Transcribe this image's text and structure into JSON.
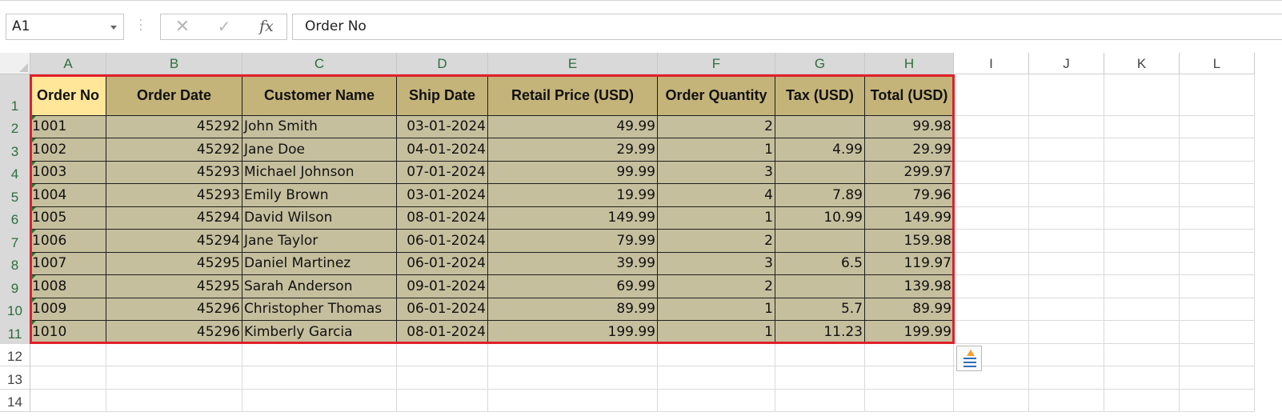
{
  "formula_bar": {
    "name_box": "A1",
    "cancel_icon": "cancel-icon",
    "enter_icon": "checkmark-icon",
    "fx_label": "fx",
    "formula_value": "Order No"
  },
  "columns": [
    "A",
    "B",
    "C",
    "D",
    "E",
    "F",
    "G",
    "H",
    "I",
    "J",
    "K",
    "L"
  ],
  "rows": [
    "1",
    "2",
    "3",
    "4",
    "5",
    "6",
    "7",
    "8",
    "9",
    "10",
    "11",
    "12",
    "13",
    "14"
  ],
  "table": {
    "headers": [
      "Order No",
      "Order Date",
      "Customer Name",
      "Ship Date",
      "Retail Price (USD)",
      "Order Quantity",
      "Tax (USD)",
      "Total (USD)"
    ],
    "rows": [
      [
        "1001",
        "45292",
        "John Smith",
        "03-01-2024",
        "49.99",
        "2",
        "",
        "99.98"
      ],
      [
        "1002",
        "45292",
        "Jane Doe",
        "04-01-2024",
        "29.99",
        "1",
        "4.99",
        "29.99"
      ],
      [
        "1003",
        "45293",
        "Michael Johnson",
        "07-01-2024",
        "99.99",
        "3",
        "",
        "299.97"
      ],
      [
        "1004",
        "45293",
        "Emily Brown",
        "03-01-2024",
        "19.99",
        "4",
        "7.89",
        "79.96"
      ],
      [
        "1005",
        "45294",
        "David Wilson",
        "08-01-2024",
        "149.99",
        "1",
        "10.99",
        "149.99"
      ],
      [
        "1006",
        "45294",
        "Jane Taylor",
        "06-01-2024",
        "79.99",
        "2",
        "",
        "159.98"
      ],
      [
        "1007",
        "45295",
        "Daniel Martinez",
        "06-01-2024",
        "39.99",
        "3",
        "6.5",
        "119.97"
      ],
      [
        "1008",
        "45295",
        "Sarah Anderson",
        "09-01-2024",
        "69.99",
        "2",
        "",
        "139.98"
      ],
      [
        "1009",
        "45296",
        "Christopher Thomas",
        "06-01-2024",
        "89.99",
        "1",
        "5.7",
        "89.99"
      ],
      [
        "1010",
        "45296",
        "Kimberly Garcia",
        "08-01-2024",
        "199.99",
        "1",
        "11.23",
        "199.99"
      ]
    ]
  },
  "colors": {
    "header_fill": "#c5b47a",
    "active_cell_fill": "#ffe699",
    "data_fill": "#c6bf9e",
    "selection_border": "#e0202a"
  },
  "quick_analysis_icon": "quick-analysis-icon"
}
